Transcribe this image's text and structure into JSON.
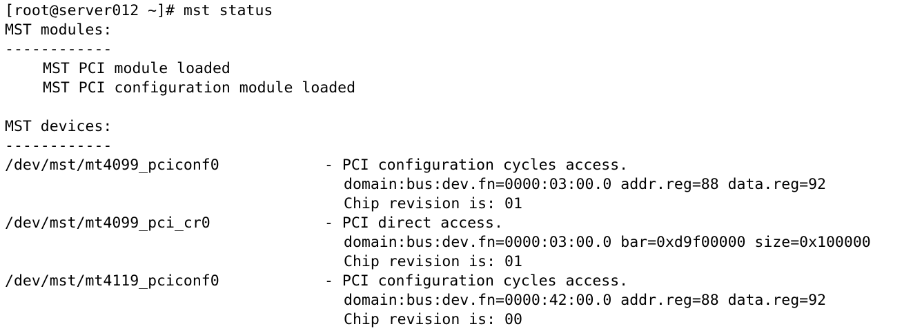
{
  "terminal": {
    "prompt": "[root@server012 ~]# ",
    "command": "mst status",
    "modules": {
      "header": "MST modules:",
      "separator": "------------",
      "items": [
        "MST PCI module loaded",
        "MST PCI configuration module loaded"
      ]
    },
    "devices": {
      "header": "MST devices:",
      "separator": "------------",
      "items": [
        {
          "path": "/dev/mst/mt4099_pciconf0",
          "access": "- PCI configuration cycles access.",
          "details": "domain:bus:dev.fn=0000:03:00.0 addr.reg=88 data.reg=92",
          "revision": "Chip revision is: 01"
        },
        {
          "path": "/dev/mst/mt4099_pci_cr0",
          "access": "- PCI direct access.",
          "details": "domain:bus:dev.fn=0000:03:00.0 bar=0xd9f00000 size=0x100000",
          "revision": "Chip revision is: 01"
        },
        {
          "path": "/dev/mst/mt4119_pciconf0",
          "access": "- PCI configuration cycles access.",
          "details": "domain:bus:dev.fn=0000:42:00.0 addr.reg=88 data.reg=92",
          "revision": "Chip revision is: 00"
        }
      ]
    }
  }
}
